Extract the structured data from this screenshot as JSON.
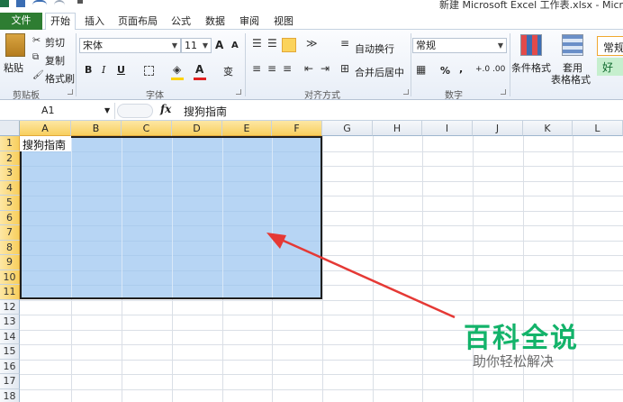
{
  "window": {
    "title": "新建 Microsoft Excel 工作表.xlsx - Microsoft"
  },
  "tabs": [
    "文件",
    "开始",
    "插入",
    "页面布局",
    "公式",
    "数据",
    "审阅",
    "视图"
  ],
  "ribbon": {
    "clipboard": {
      "paste": "粘贴",
      "cut": "剪切",
      "copy": "复制",
      "format_painter": "格式刷",
      "label": "剪贴板"
    },
    "font": {
      "name": "宋体",
      "size": "11",
      "bold": "B",
      "italic": "I",
      "underline": "U",
      "grow": "A",
      "shrink": "A",
      "phonetic": "变",
      "label": "字体"
    },
    "alignment": {
      "wrap_text": "自动换行",
      "merge_center": "合并后居中",
      "label": "对齐方式"
    },
    "number": {
      "format": "常规",
      "percent": "%",
      "comma": ",",
      "label": "数字"
    },
    "styles": {
      "conditional": "条件格式",
      "table_format_1": "套用",
      "table_format_2": "表格格式",
      "normal": "常规",
      "good": "好"
    }
  },
  "formula_bar": {
    "cell_ref": "A1",
    "fx": "fx",
    "content": "搜狗指南"
  },
  "grid": {
    "columns": [
      "A",
      "B",
      "C",
      "D",
      "E",
      "F",
      "G",
      "H",
      "I",
      "J",
      "K",
      "L"
    ],
    "rows": [
      "1",
      "2",
      "3",
      "4",
      "5",
      "6",
      "7",
      "8",
      "9",
      "10",
      "11",
      "12",
      "13",
      "14",
      "15",
      "16",
      "17",
      "18"
    ],
    "cell_a1": "搜狗指南"
  },
  "watermark": {
    "title": "百科全说",
    "subtitle": "助你轻松解决"
  },
  "colors": {
    "file_tab": "#2e7d32",
    "selection": "#99c3f0",
    "header_selected": "#f8cf5e",
    "arrow": "#e53935",
    "watermark": "#13b36a"
  }
}
